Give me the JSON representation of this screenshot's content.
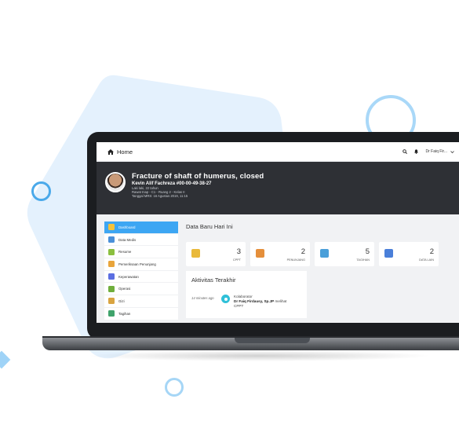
{
  "navbar": {
    "home_label": "Home",
    "user_label": "Dr Faiq Fir..."
  },
  "patient": {
    "title": "Fracture of shaft of humerus, closed",
    "name": "Kevin Alif Fachreza #00-00-49-38-27",
    "line1": "Laki laki, 22 tahun",
    "line2": "Rawat Inap - C1 - Ruang 2 - Kelas II",
    "line3": "Tanggal MRS: 16 Agustus 2019, 11:15"
  },
  "sidebar": {
    "items": [
      {
        "label": "Dashboard",
        "icon": "dashboard-icon",
        "color": "#f5c23a"
      },
      {
        "label": "Data Medis",
        "icon": "medical-data-icon",
        "color": "#4a90d9"
      },
      {
        "label": "Resume",
        "icon": "resume-icon",
        "color": "#8bbf3f"
      },
      {
        "label": "Pemeriksaan Penunjang",
        "icon": "lab-exam-icon",
        "color": "#e9a53b"
      },
      {
        "label": "Keperawatan",
        "icon": "nursing-icon",
        "color": "#5b6ee1"
      },
      {
        "label": "Operasi",
        "icon": "surgery-icon",
        "color": "#6fae3c"
      },
      {
        "label": "Gizi",
        "icon": "nutrition-icon",
        "color": "#d9a441"
      },
      {
        "label": "Tagihan",
        "icon": "bill-icon",
        "color": "#3fa36b"
      }
    ]
  },
  "main": {
    "title": "Data Baru Hari Ini",
    "cards": [
      {
        "value": "3",
        "label": "CPPT",
        "icon": "cppt-icon",
        "color": "#e9b93a"
      },
      {
        "value": "2",
        "label": "PENUNJANG",
        "icon": "support-icon",
        "color": "#e58f3b"
      },
      {
        "value": "5",
        "label": "TAGIHAN",
        "icon": "invoice-icon",
        "color": "#4a9fd9"
      },
      {
        "value": "2",
        "label": "DATA LAIN",
        "icon": "other-data-icon",
        "color": "#4a7fd9"
      }
    ]
  },
  "activity": {
    "title": "Aktivitas Terakhir",
    "time": "14 minutes ago",
    "line1": "Kolaborator",
    "actor": "Dr Faiq Firdausy, Sp.JP",
    "action": "melihat",
    "line3": "CPPT"
  }
}
